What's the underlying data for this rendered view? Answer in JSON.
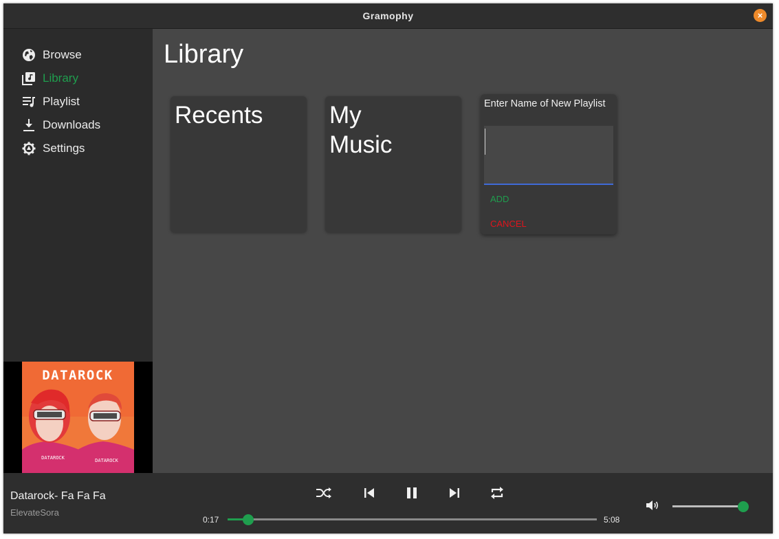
{
  "window": {
    "title": "Gramophy",
    "close_symbol": "×",
    "accent": "#ee8a2a"
  },
  "sidebar": {
    "items": [
      {
        "label": "Browse",
        "icon": "globe-icon",
        "active": false
      },
      {
        "label": "Library",
        "icon": "library-music-icon",
        "active": true
      },
      {
        "label": "Playlist",
        "icon": "playlist-icon",
        "active": false
      },
      {
        "label": "Downloads",
        "icon": "download-icon",
        "active": false
      },
      {
        "label": "Settings",
        "icon": "gear-icon",
        "active": false
      }
    ],
    "active_color": "#1f9e4e",
    "album_art": {
      "text": "DATAROCK",
      "shirt_text_left": "DATAROCK",
      "shirt_text_right": "DATAROCK"
    }
  },
  "main": {
    "title": "Library",
    "cards": [
      {
        "title": "Recents"
      },
      {
        "title": "My\nMusic"
      }
    ],
    "dialog": {
      "title": "Enter Name of New Playlist",
      "input_value": "",
      "add_label": "ADD",
      "cancel_label": "CANCEL"
    }
  },
  "player": {
    "track_title": "Datarock- Fa Fa Fa",
    "artist": "ElevateSora",
    "elapsed": "0:17",
    "duration": "5:08",
    "progress_fraction": 0.055,
    "volume_fraction": 1.0,
    "state": "playing",
    "controls": [
      "shuffle-icon",
      "previous-icon",
      "pause-icon",
      "next-icon",
      "repeat-icon"
    ],
    "accent": "#1f9e4e"
  }
}
